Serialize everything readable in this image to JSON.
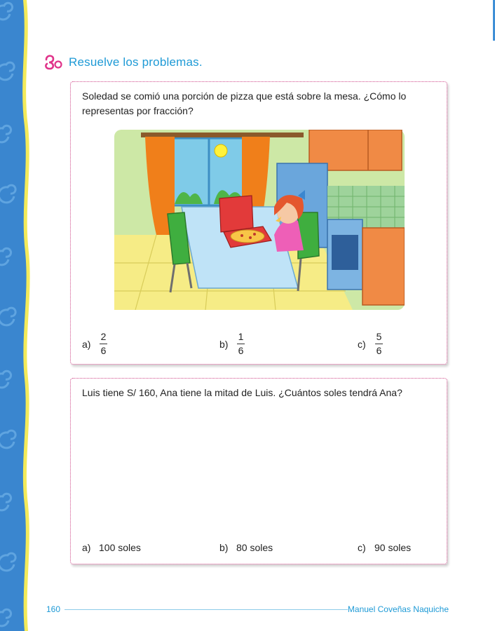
{
  "heading": {
    "title": "Resuelve los problemas."
  },
  "problem1": {
    "question": "Soledad se comió una porción de pizza que está sobre la mesa. ¿Cómo lo representas por fracción?",
    "options": [
      {
        "label": "a)",
        "numerator": "2",
        "denominator": "6"
      },
      {
        "label": "b)",
        "numerator": "1",
        "denominator": "6"
      },
      {
        "label": "c)",
        "numerator": "5",
        "denominator": "6"
      }
    ]
  },
  "problem2": {
    "question": "Luis tiene S/ 160, Ana tiene la mitad de Luis. ¿Cuántos soles tendrá Ana?",
    "options": [
      {
        "label": "a)",
        "text": "100 soles"
      },
      {
        "label": "b)",
        "text": "80 soles"
      },
      {
        "label": "c)",
        "text": "90 soles"
      }
    ]
  },
  "footer": {
    "page_number": "160",
    "author": "Manuel Coveñas Naquiche"
  },
  "colors": {
    "accent_blue": "#1e9ad6",
    "strip_blue": "#3a86cf",
    "strip_yellow": "#f3ea5a",
    "card_border": "#d04a8a"
  }
}
